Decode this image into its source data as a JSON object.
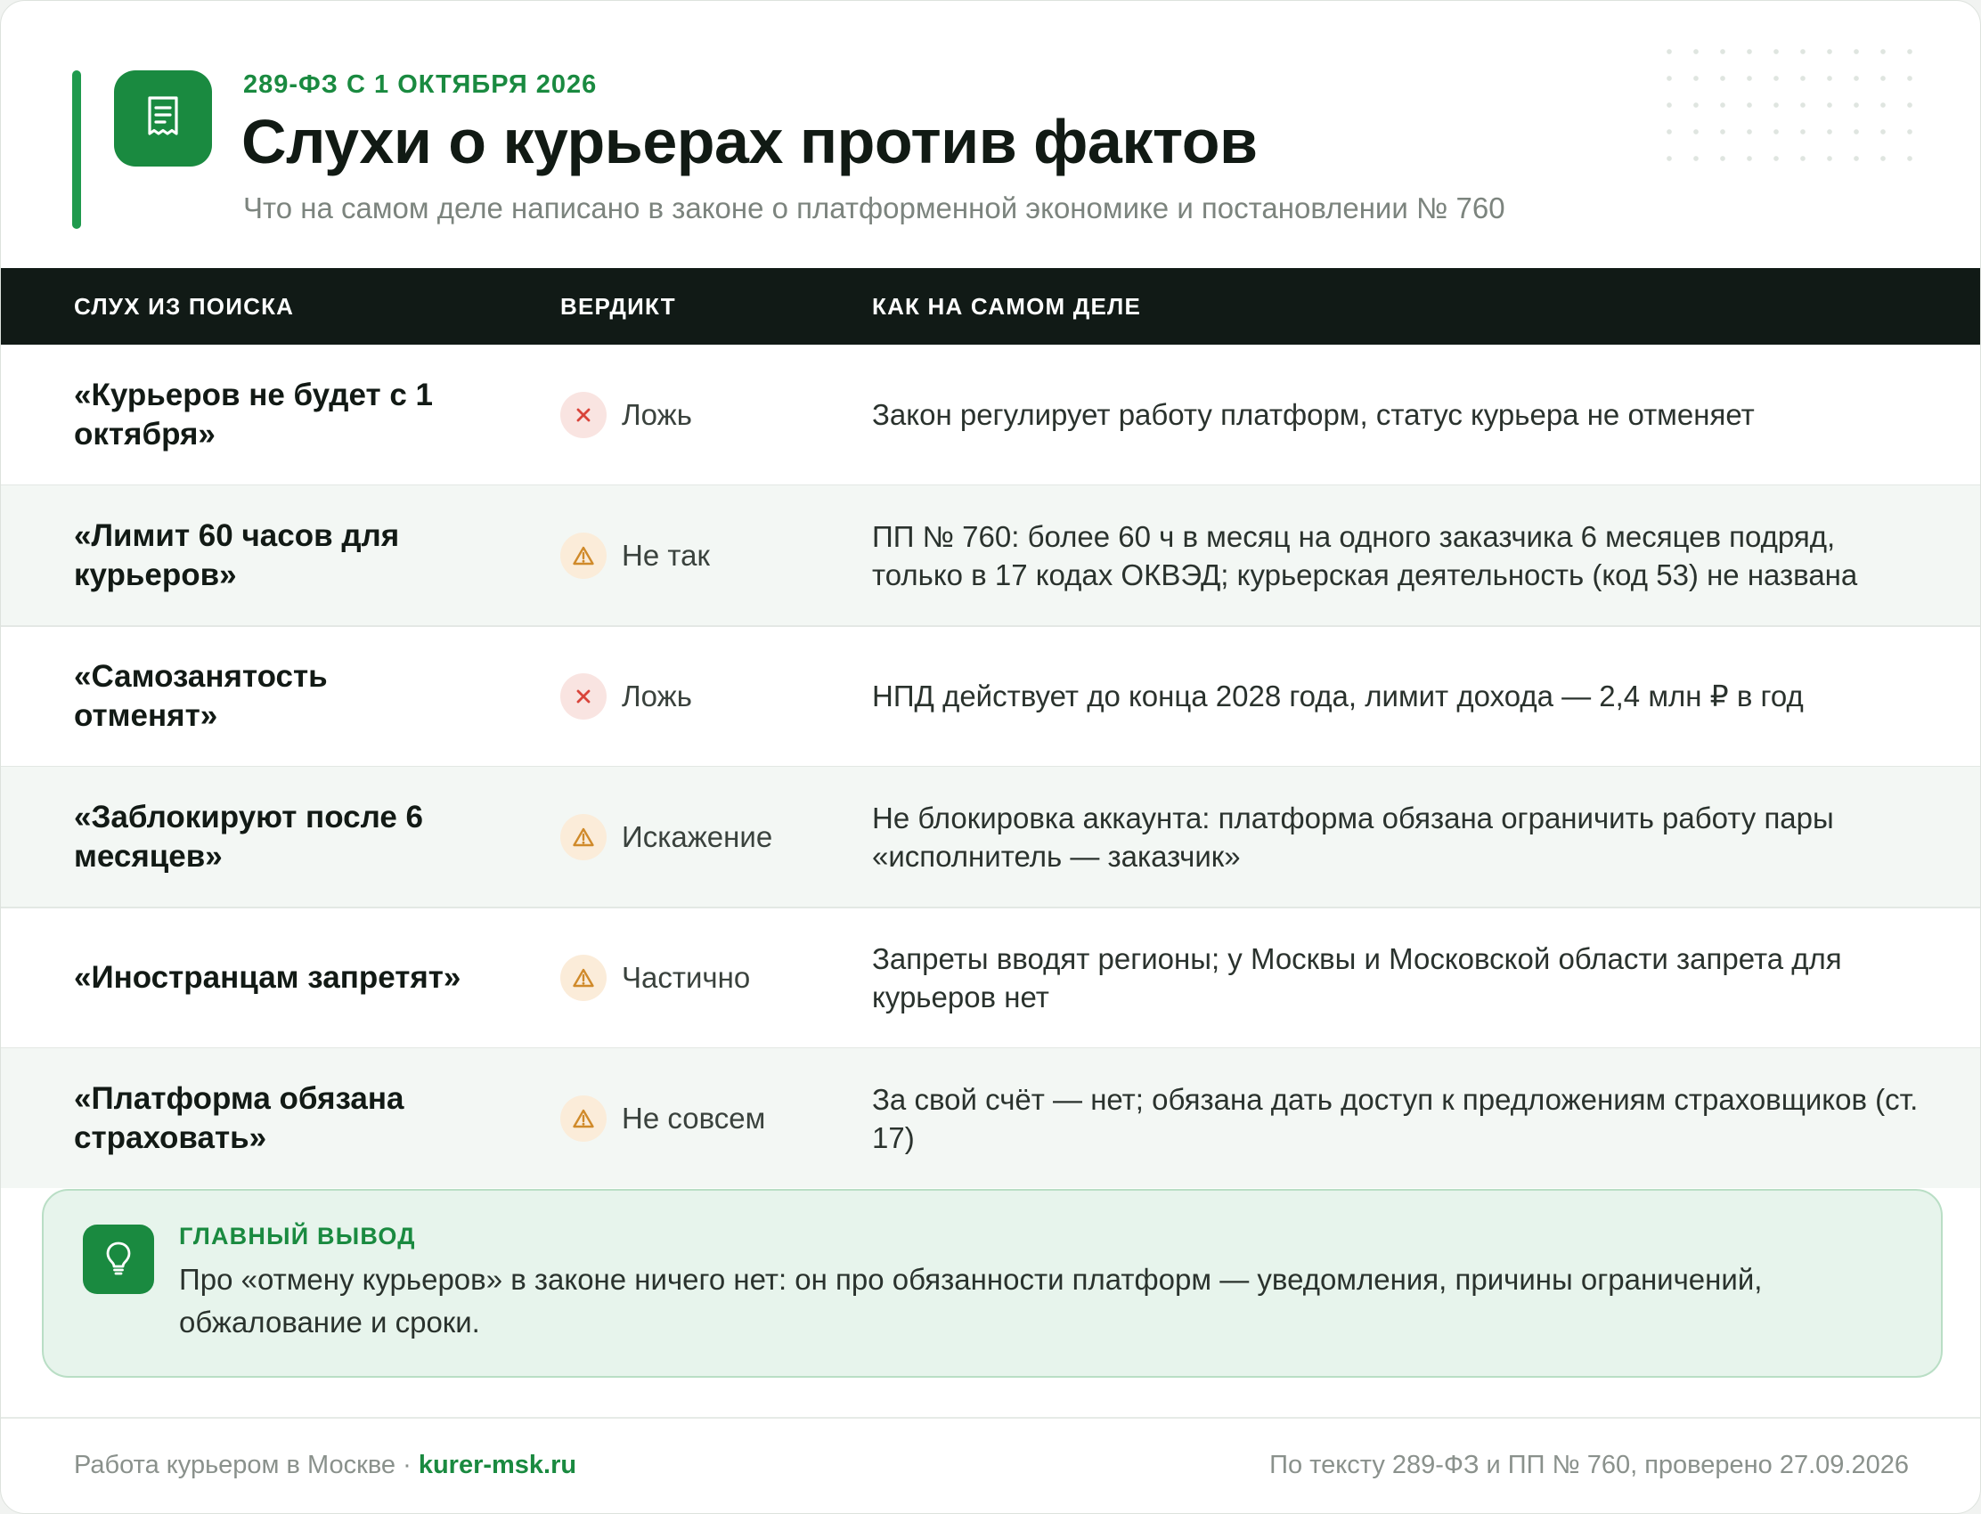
{
  "header": {
    "eyebrow": "289-ФЗ С 1 ОКТЯБРЯ 2026",
    "title": "Слухи о курьерах против фактов",
    "subtitle": "Что на самом деле написано в законе о платформенной экономике и постановлении № 760",
    "icon": "receipt-document-icon"
  },
  "table": {
    "columns": [
      "СЛУХ ИЗ ПОИСКА",
      "ВЕРДИКТ",
      "КАК НА САМОМ ДЕЛЕ"
    ],
    "rows": [
      {
        "rumor": "«Курьеров не будет с 1 октября»",
        "verdict": "Ложь",
        "verdict_icon": "cross-icon",
        "fact": "Закон регулирует работу платформ, статус курьера не отменяет"
      },
      {
        "rumor": "«Лимит 60 часов для курьеров»",
        "verdict": "Не так",
        "verdict_icon": "warning-icon",
        "fact": "ПП № 760: более 60 ч в месяц на одного заказчика 6 месяцев подряд, только в 17 кодах ОКВЭД; курьерская деятельность (код 53) не названа"
      },
      {
        "rumor": "«Самозанятость отменят»",
        "verdict": "Ложь",
        "verdict_icon": "cross-icon",
        "fact": "НПД действует до конца 2028 года, лимит дохода — 2,4 млн ₽ в год"
      },
      {
        "rumor": "«Заблокируют после 6 месяцев»",
        "verdict": "Искажение",
        "verdict_icon": "warning-icon",
        "fact": "Не блокировка аккаунта: платформа обязана ограничить работу пары «исполнитель — заказчик»"
      },
      {
        "rumor": "«Иностранцам запретят»",
        "verdict": "Частично",
        "verdict_icon": "warning-icon",
        "fact": "Запреты вводят регионы; у Москвы и Московской области запрета для курьеров нет"
      },
      {
        "rumor": "«Платформа обязана страховать»",
        "verdict": "Не совсем",
        "verdict_icon": "warning-icon",
        "fact": "За свой счёт — нет; обязана дать доступ к предложениям страховщиков (ст. 17)"
      }
    ]
  },
  "conclusion": {
    "icon": "lightbulb-icon",
    "heading": "ГЛАВНЫЙ ВЫВОД",
    "text": "Про «отмену курьеров» в законе ничего нет: он про обязанности платформ — уведомления, причины ограничений, обжалование и сроки."
  },
  "footer": {
    "left_text": "Работа курьером в Москве · ",
    "site": "kurer-msk.ru",
    "right_text": "По тексту 289-ФЗ и ПП № 760, проверено 27.09.2026"
  },
  "colors": {
    "brand_green": "#1a8a40",
    "header_dark": "#111a16",
    "false_red": "#d9443a",
    "warning_amber": "#d08a2a"
  }
}
